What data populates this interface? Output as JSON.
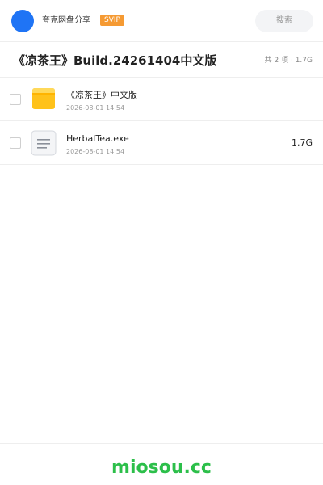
{
  "header": {
    "app_name": "夸克网盘分享",
    "badge": "SVIP",
    "search_placeholder": "搜索",
    "avatar_color": "#1f74f5",
    "badge_color": "#f59a33"
  },
  "folder": {
    "title": "《凉茶王》Build.24261404中文版",
    "summary": "共 2 项 · 1.7G"
  },
  "files": [
    {
      "name": "《凉茶王》中文版",
      "date": "2026-08-01 14:54",
      "size": "",
      "icon": "folder-icon"
    },
    {
      "name": "HerbalTea.exe",
      "date": "2026-08-01 14:54",
      "size": "1.7G",
      "icon": "file-icon"
    }
  ],
  "footer": {
    "brand": "miosou.cc",
    "brand_color": "#2cbf4a"
  }
}
